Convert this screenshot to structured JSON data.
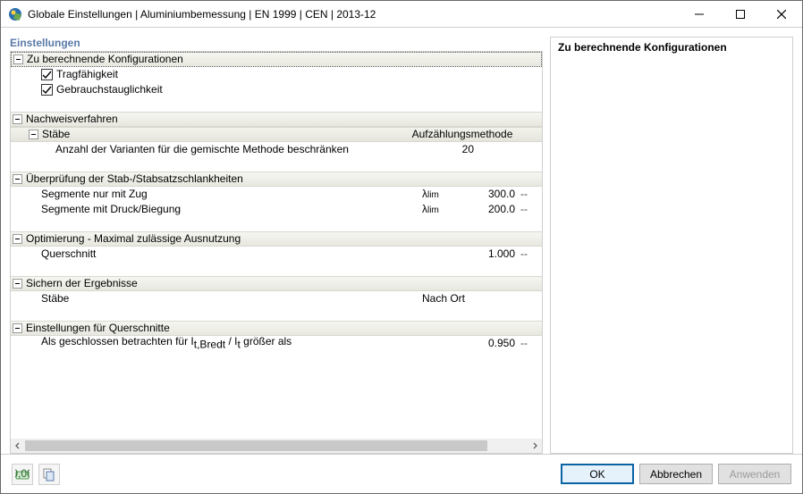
{
  "window": {
    "title": "Globale Einstellungen | Aluminiumbemessung | EN 1999 | CEN | 2013-12"
  },
  "left_title": "Einstellungen",
  "right_title": "Zu berechnende Konfigurationen",
  "sections": {
    "configs": {
      "header": "Zu berechnende Konfigurationen",
      "items": [
        {
          "label": "Tragfähigkeit",
          "checked": true
        },
        {
          "label": "Gebrauchstauglichkeit",
          "checked": true
        }
      ]
    },
    "method": {
      "header": "Nachweisverfahren",
      "sub_header": "Stäbe",
      "sub_value": "Aufzählungsmethode",
      "row1": {
        "label": "Anzahl der Varianten für die gemischte Methode beschränken",
        "value": "20"
      }
    },
    "slenderness": {
      "header": "Überprüfung der Stab-/Stabsatzschlankheiten",
      "row1": {
        "label": "Segmente nur mit Zug",
        "sym": "λlim",
        "value": "300.0",
        "unit": "--"
      },
      "row2": {
        "label": "Segmente mit Druck/Biegung",
        "sym": "λlim",
        "value": "200.0",
        "unit": "--"
      }
    },
    "optim": {
      "header": "Optimierung - Maximal zulässige Ausnutzung",
      "row1": {
        "label": "Querschnitt",
        "value": "1.000",
        "unit": "--"
      }
    },
    "save": {
      "header": "Sichern der Ergebnisse",
      "row1": {
        "label": "Stäbe",
        "value": "Nach Ort"
      }
    },
    "cross": {
      "header": "Einstellungen für Querschnitte",
      "row1": {
        "label_pre": "Als geschlossen betrachten für I",
        "label_mid": "t,Bredt",
        "label_sep": " / I",
        "label_suf": "t",
        "label_end": " größer als",
        "value": "0.950",
        "unit": "--"
      }
    }
  },
  "buttons": {
    "ok": "OK",
    "cancel": "Abbrechen",
    "apply": "Anwenden"
  }
}
